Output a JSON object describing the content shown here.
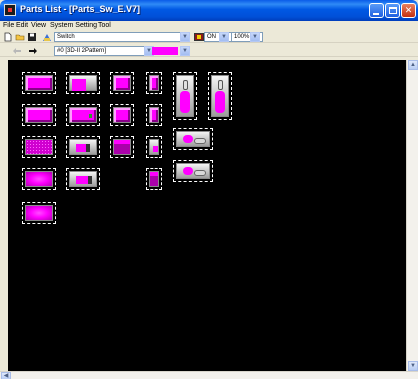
{
  "window": {
    "title": "Parts List - [Parts_Sw_E.V7]"
  },
  "menu": {
    "items": [
      "File",
      "Edit",
      "View",
      "System Setting",
      "Tool"
    ]
  },
  "toolbar": {
    "part_type": "Switch",
    "state": "ON",
    "zoom": "100%",
    "pattern": "#0 [3D-II 2Pattern]",
    "fill_color": "#ff00ff"
  },
  "colors": {
    "canvas": "#000000",
    "part_accent": "#ff00ff",
    "titlebar": "#0a5ce8"
  },
  "icons": {
    "back": "arrow-left",
    "forward": "arrow-right",
    "new": "document-new",
    "open": "folder-open",
    "save": "floppy-disk"
  }
}
